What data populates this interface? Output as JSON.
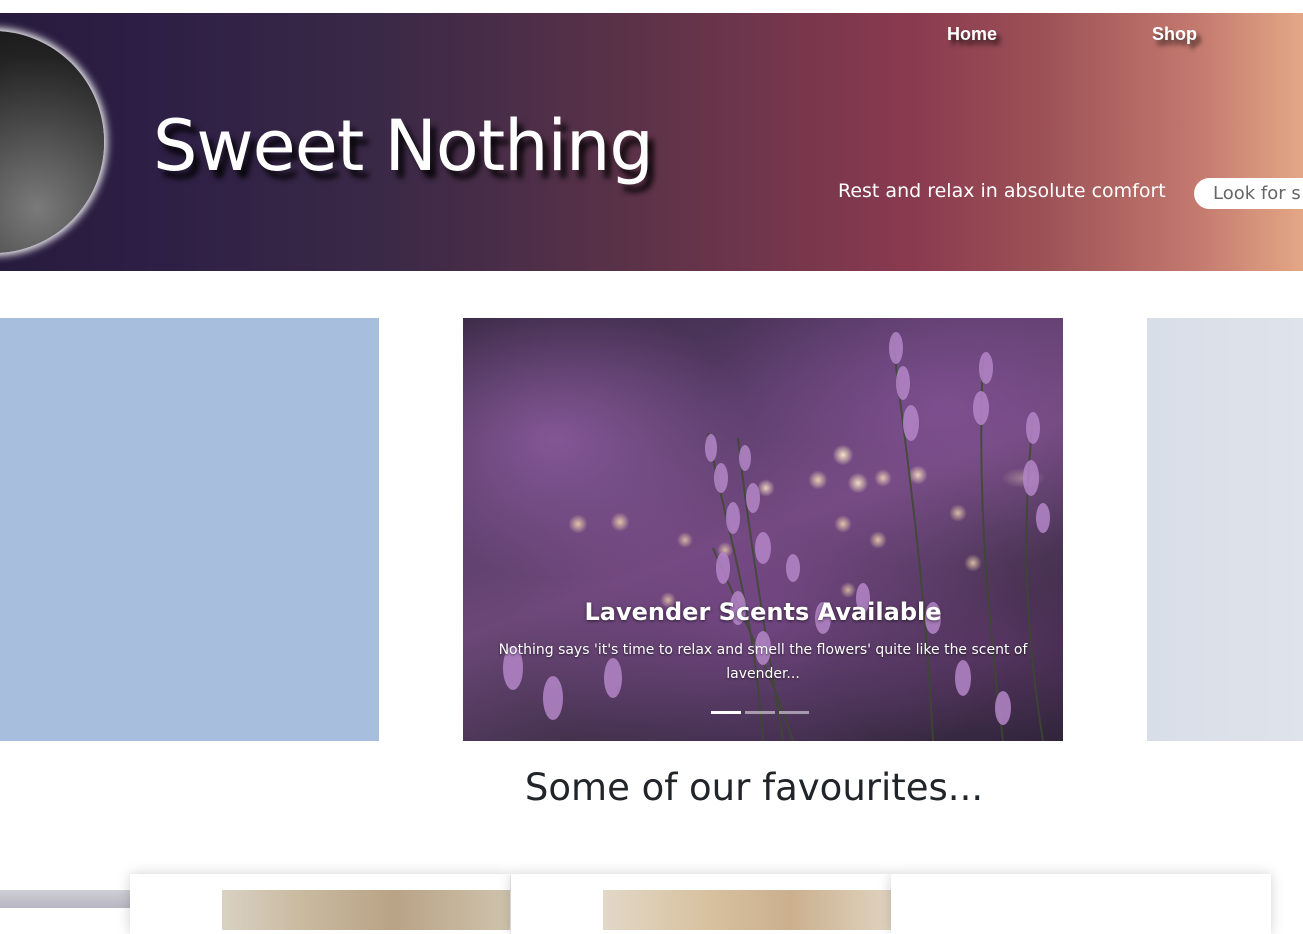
{
  "header": {
    "site_title": "Sweet Nothing",
    "tagline": "Rest and relax in absolute comfort",
    "search_placeholder": "Look for s",
    "nav": [
      {
        "label": "Home"
      },
      {
        "label": "Shop"
      }
    ]
  },
  "carousel": {
    "slide_title": "Lavender Scents Available",
    "slide_text": "Nothing says 'it's time to relax and smell the flowers' quite like the scent of lavender...",
    "indicator_count": 3,
    "active_indicator": 0
  },
  "favourites": {
    "heading": "Some of our favourites..."
  },
  "colors": {
    "banner_start": "#271b3d",
    "banner_mid": "#8a3a4f",
    "banner_end": "#e3a786",
    "side_left_panel": "#a8bedd",
    "side_right_panel": "#d8dee8",
    "heading_text": "#212529"
  }
}
